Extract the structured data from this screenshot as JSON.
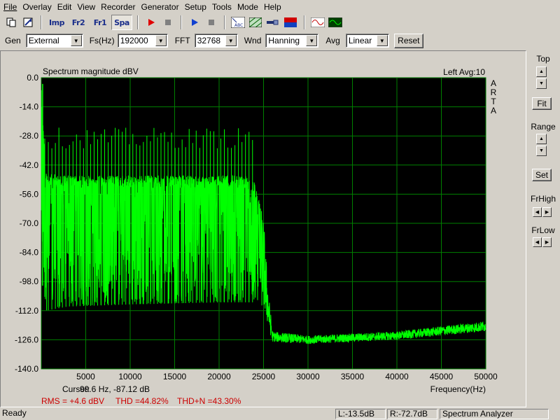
{
  "menu": [
    "File",
    "Overlay",
    "Edit",
    "View",
    "Recorder",
    "Generator",
    "Setup",
    "Tools",
    "Mode",
    "Help"
  ],
  "toolbar": {
    "mode_imp": "Imp",
    "mode_fr2": "Fr2",
    "mode_fr1": "Fr1",
    "mode_spa": "Spa",
    "abc_label": "ABC"
  },
  "controls": {
    "gen_label": "Gen",
    "gen_value": "External",
    "fs_label": "Fs(Hz)",
    "fs_value": "192000",
    "fft_label": "FFT",
    "fft_value": "32768",
    "wnd_label": "Wnd",
    "wnd_value": "Hanning",
    "avg_label": "Avg",
    "avg_value": "Linear",
    "reset_label": "Reset"
  },
  "plot": {
    "title": "Spectrum magnitude dBV",
    "channel_info": "Left  Avg:10",
    "brand": [
      "A",
      "R",
      "T",
      "A"
    ],
    "cursor_label": "Cursor:",
    "cursor_value": "99.6 Hz, -87.12 dB",
    "rms_text": "RMS =   +4.6 dBV",
    "thd_text": "THD =44.82%",
    "thdn_text": "THD+N =43.30%",
    "colors": {
      "plot_bg": "#000000",
      "grid": "#008000",
      "trace": "#00ff00",
      "stats": "#cc0000"
    }
  },
  "chart_data": {
    "type": "line",
    "title": "Spectrum magnitude dBV",
    "xlabel": "Frequency(Hz)",
    "ylabel": "",
    "xlim": [
      0,
      50000
    ],
    "ylim": [
      -140,
      0
    ],
    "x_ticks": [
      5000,
      10000,
      15000,
      20000,
      25000,
      30000,
      35000,
      40000,
      45000,
      50000
    ],
    "y_ticks": [
      0.0,
      -14.0,
      -28.0,
      -42.0,
      -56.0,
      -70.0,
      -84.0,
      -98.0,
      -112.0,
      -126.0,
      -140.0
    ],
    "grid": true,
    "series": [
      {
        "color": "#00ff00",
        "envelope_top": [
          [
            0,
            -4
          ],
          [
            500,
            -46
          ],
          [
            3000,
            -47
          ],
          [
            10000,
            -47
          ],
          [
            20000,
            -47
          ],
          [
            23000,
            -47
          ],
          [
            24000,
            -50
          ],
          [
            25000,
            -67
          ],
          [
            25500,
            -100
          ],
          [
            26000,
            -122
          ],
          [
            30000,
            -124
          ],
          [
            40000,
            -122
          ],
          [
            50000,
            -117
          ]
        ],
        "envelope_bottom": [
          [
            0,
            -80
          ],
          [
            500,
            -112
          ],
          [
            3000,
            -110
          ],
          [
            10000,
            -109
          ],
          [
            20000,
            -108
          ],
          [
            23000,
            -108
          ],
          [
            24000,
            -108
          ],
          [
            25000,
            -112
          ],
          [
            25500,
            -120
          ],
          [
            26000,
            -127
          ],
          [
            30000,
            -128
          ],
          [
            40000,
            -126
          ],
          [
            50000,
            -122
          ]
        ],
        "harmonic_peaks_x": [
          198,
          396,
          594,
          792,
          990
        ],
        "harmonic_peak_level": -32
      }
    ]
  },
  "right_panel": {
    "top_label": "Top",
    "fit_label": "Fit",
    "range_label": "Range",
    "set_label": "Set",
    "frhigh_label": "FrHigh",
    "frlow_label": "FrLow"
  },
  "status": {
    "ready": "Ready",
    "left_level": "L:-13.5dB",
    "right_level": "R:-72.7dB",
    "mode": "Spectrum Analyzer"
  }
}
